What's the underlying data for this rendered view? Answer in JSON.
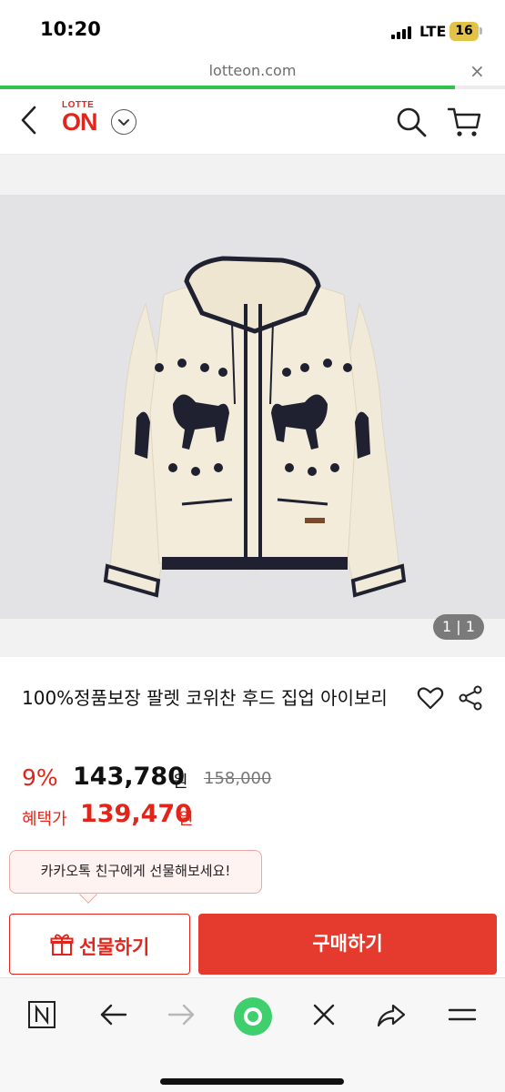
{
  "status_bar": {
    "time": "10:20",
    "network": "LTE",
    "battery": "16"
  },
  "browser": {
    "url": "lotteon.com",
    "close_label": "×",
    "load_progress": 0.9
  },
  "site_header": {
    "logo_top": "LOTTE",
    "logo_main": "ON"
  },
  "gallery": {
    "counter": "1 | 1"
  },
  "product": {
    "title": "100%정품보장 팔렛 코위찬 후드 집업 아이보리",
    "discount": "9%",
    "price": "143,780",
    "currency": "원",
    "original_price": "158,000",
    "benefit_label": "혜택가",
    "benefit_price": "139,470"
  },
  "tooltip": {
    "text": "카카오톡 친구에게 선물해보세요!"
  },
  "actions": {
    "gift_label": "선물하기",
    "buy_label": "구매하기"
  },
  "colors": {
    "brand_red": "#e1251b",
    "buy_red": "#e53b2e",
    "progress_green": "#2ec44d"
  },
  "icons": {
    "back": "chevron-left-icon",
    "dropdown": "chevron-down-icon",
    "search": "search-icon",
    "cart": "cart-icon",
    "wish": "heart-icon",
    "share": "share-icon",
    "gift": "gift-icon",
    "naver": "naver-n-icon",
    "browser_back": "arrow-left-icon",
    "browser_forward": "arrow-right-icon",
    "green_dot": "green-dot-icon",
    "close": "close-icon",
    "browser_share": "share-arrow-icon",
    "menu": "menu-icon"
  }
}
